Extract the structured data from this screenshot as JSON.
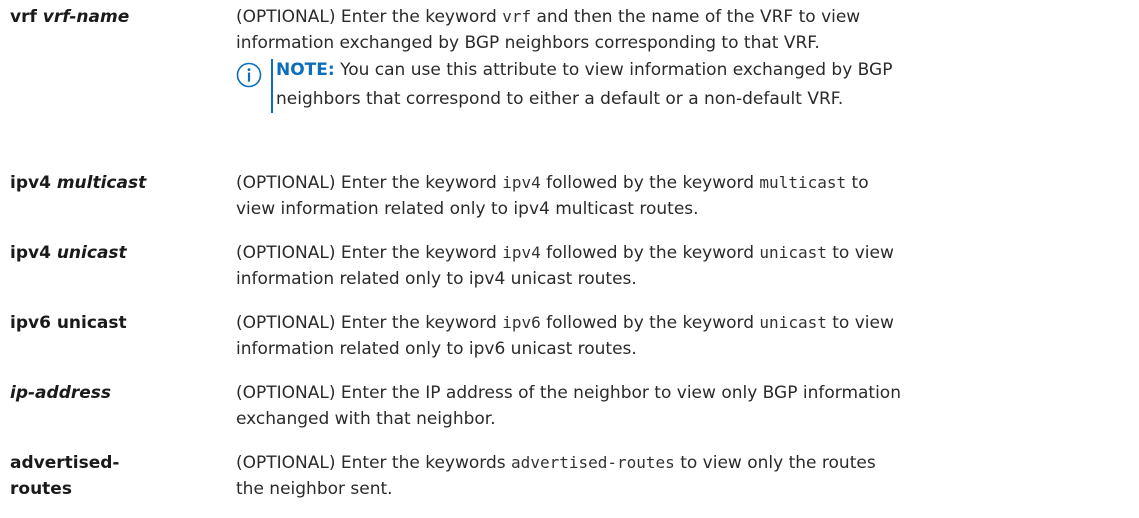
{
  "rows": [
    {
      "term": {
        "a": "vrf ",
        "b": "vrf-name"
      },
      "desc": {
        "t1": "(OPTIONAL) Enter the keyword ",
        "c1": "vrf",
        "t2": " and then the name of the VRF to view",
        "t3": "information exchanged by BGP neighbors corresponding to that VRF."
      },
      "note": {
        "icon": "info-circle-icon",
        "label": "NOTE:",
        "line1": " You can use this attribute to view information exchanged by BGP",
        "line2": "neighbors that correspond to either a default or a non-default VRF."
      }
    },
    {
      "term": {
        "a": "ipv4 ",
        "b": "multicast"
      },
      "desc": {
        "t1": "(OPTIONAL) Enter the keyword ",
        "c1": "ipv4",
        "t2": " followed by the keyword ",
        "c2": "multicast",
        "t3": " to",
        "t4": "view information related only to ipv4 multicast routes."
      }
    },
    {
      "term": {
        "a": "ipv4 ",
        "b": "unicast"
      },
      "desc": {
        "t1": "(OPTIONAL) Enter the keyword ",
        "c1": "ipv4",
        "t2": " followed by the keyword ",
        "c2": "unicast",
        "t3": " to view",
        "t4": "information related only to ipv4 unicast routes."
      }
    },
    {
      "term": {
        "a": "ipv6 unicast"
      },
      "desc": {
        "t1": "(OPTIONAL) Enter the keyword ",
        "c1": "ipv6",
        "t2": " followed by the keyword ",
        "c2": "unicast",
        "t3": " to view",
        "t4": "information related only to ipv6 unicast routes."
      }
    },
    {
      "term": {
        "b": "ip-address"
      },
      "desc": {
        "t1": "(OPTIONAL) Enter the IP address of the neighbor to view only BGP information",
        "t2": "exchanged with that neighbor."
      }
    },
    {
      "term": {
        "a": "advertised-",
        "a2": "routes"
      },
      "desc": {
        "t1": "(OPTIONAL) Enter the keywords ",
        "c1": "advertised-routes",
        "t2": " to view only the routes",
        "t3": "the neighbor sent."
      }
    }
  ],
  "colors": {
    "note_accent": "#0a6ebd",
    "text": "#2a2a2a"
  }
}
